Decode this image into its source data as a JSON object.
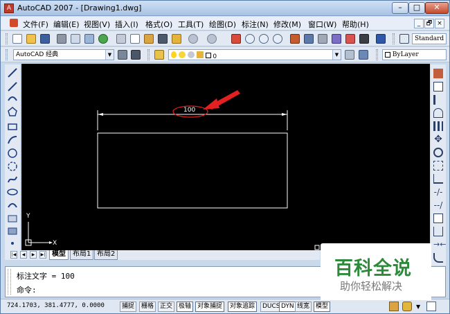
{
  "window": {
    "title": "AutoCAD 2007 - [Drawing1.dwg]",
    "controls": {
      "minimize": "–",
      "maximize": "□",
      "close": "✕"
    }
  },
  "menubar": {
    "items": [
      "文件(F)",
      "编辑(E)",
      "视图(V)",
      "插入(I)",
      "格式(O)",
      "工具(T)",
      "绘图(D)",
      "标注(N)",
      "修改(M)",
      "窗口(W)",
      "帮助(H)"
    ],
    "mdi": {
      "minimize": "_",
      "restore": "🗗",
      "close": "×"
    }
  },
  "toolbar": {
    "text_style": "Standard"
  },
  "properties_bar": {
    "workspace": "AutoCAD 经典",
    "layer": "0",
    "linetype": "ByLayer"
  },
  "drawing": {
    "dimension_text": "100",
    "ucs_x": "X",
    "ucs_y": "Y"
  },
  "tabs": [
    "模型",
    "布局1",
    "布局2"
  ],
  "command": {
    "history": "标注文字 = 100",
    "prompt": "命令:"
  },
  "status": {
    "coords": "724.1703, 381.4777, 0.0000",
    "buttons": [
      "捕捉",
      "栅格",
      "正交",
      "极轴",
      "对象捕捉",
      "对象追踪",
      "DUCS",
      "DYN",
      "线宽",
      "模型"
    ]
  },
  "watermark": {
    "title": "百科全说",
    "subtitle": "助你轻松解决"
  },
  "colors": {
    "canvas": "#000000",
    "annotation": "#e2201f",
    "geometry": "#ffffff",
    "watermark_green": "#2d8a3a"
  }
}
